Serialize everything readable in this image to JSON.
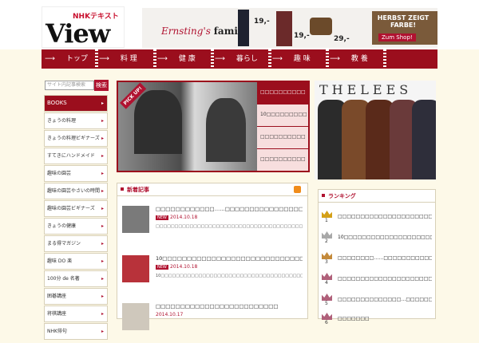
{
  "header": {
    "logo_sub": "NHKテキスト",
    "logo_main": "View"
  },
  "ad": {
    "brand": "Ernsting's",
    "brand_bold": "family",
    "prices": [
      "19,-",
      "19,-",
      "29,-"
    ],
    "cta_text": "HERBST ZEIGT FARBE!",
    "cta_button": "Zum Shop!"
  },
  "nav": {
    "items": [
      {
        "label": "トップ"
      },
      {
        "label": "料 理"
      },
      {
        "label": "健 康"
      },
      {
        "label": "暮らし"
      },
      {
        "label": "趣 味"
      },
      {
        "label": "教 養"
      }
    ]
  },
  "search": {
    "placeholder": "サイト内記事検索",
    "button": "検索"
  },
  "sidebar": {
    "items": [
      {
        "label": "BOOKS"
      },
      {
        "label": "きょうの料理"
      },
      {
        "label": "きょうの料理ビギナーズ"
      },
      {
        "label": "すてきにハンドメイド"
      },
      {
        "label": "趣味の園芸"
      },
      {
        "label": "趣味の園芸やさいの時間"
      },
      {
        "label": "趣味の園芸ビギナーズ"
      },
      {
        "label": "きょうの健康"
      },
      {
        "label": "まる得マガジン"
      },
      {
        "label": "趣味 DO 楽"
      },
      {
        "label": "100分 de 名著"
      },
      {
        "label": "囲碁講座"
      },
      {
        "label": "将棋講座"
      },
      {
        "label": "NHK俳句"
      }
    ]
  },
  "pickup": {
    "tag": "PICK UP!",
    "items": [
      {
        "label": "□□□□□□□□□□"
      },
      {
        "label": "10□□□□□□□□□"
      },
      {
        "label": "□□□□□□□□□□"
      },
      {
        "label": "□□□□□□□□□□"
      }
    ]
  },
  "side_ad": {
    "title": "THELEES"
  },
  "new_articles": {
    "title": "新着記事",
    "articles": [
      {
        "headline": "□□□□□□□□□□□□……□□□□□□□□□□□□□□□□□□□□□□□□□□□",
        "badge": "NEW",
        "date": "2014.10.18",
        "body": "□□□□□□□□□□□□□□□□□□□□□□□□□□□□□□□□□□□□□□□□□□□□□□□□□□□□□□□□□□□□…"
      },
      {
        "headline": "10□□□□□□□□□□□□□□□□□□□□□□□□□□□□□",
        "badge": "NEW",
        "date": "2014.10.18",
        "body": "10□□□□□□□□□□□□□□□□□□□□□□□□□□□□□□□□□□□□□□□□□□□□□□□□□□□□□□□□…"
      },
      {
        "headline": "□□□□□□□□□□□□□□□□□□□□□□□□□",
        "badge": "",
        "date": "2014.10.17",
        "body": ""
      }
    ]
  },
  "ranking": {
    "title": "ランキング",
    "items": [
      {
        "num": "1",
        "text": "□□□□□□□□□□□□□□□□□□□□□□",
        "crown_color": "#d4a017"
      },
      {
        "num": "2",
        "text": "10□□□□□□□□□□□□□□□□□□□□□",
        "crown_color": "#a8a8a8"
      },
      {
        "num": "3",
        "text": "□□□□□□□□……□□□□□□□□□□□□",
        "crown_color": "#c48a3a"
      },
      {
        "num": "4",
        "text": "□□□□□□□□□□□□□□□□□□□□□□",
        "crown_color": "#b0607a"
      },
      {
        "num": "5",
        "text": "□□□□□□□□□□□□□□…□□□□□□□",
        "crown_color": "#b0607a"
      },
      {
        "num": "6",
        "text": "□□□□□□□",
        "crown_color": "#b0607a"
      }
    ]
  },
  "colors": {
    "accent": "#9b0e1d",
    "background": "#fdf9e8"
  }
}
